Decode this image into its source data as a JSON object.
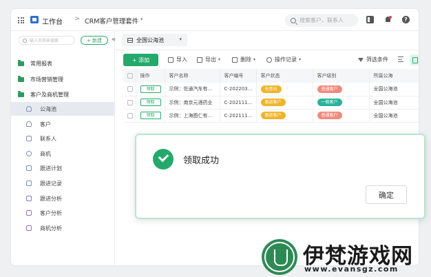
{
  "topbar": {
    "workspace_label": "工作台",
    "crumb_separator": ">",
    "app_title": "CRM客户管理套件",
    "app_caret": "▾",
    "search_placeholder": "搜索客户、联系人",
    "help_label": "?"
  },
  "sidebar": {
    "search_placeholder": "输入名称来搜索",
    "new_label": "+ 新建",
    "collapse_label": "«",
    "groups": [
      "常用报表",
      "市场营销管理",
      "客户及商机管理"
    ],
    "items": [
      {
        "label": "公海池",
        "icon": "person-icon",
        "active": true
      },
      {
        "label": "客户",
        "icon": "person-icon"
      },
      {
        "label": "联系人",
        "icon": "contact-card-icon"
      },
      {
        "label": "商机",
        "icon": "target-icon"
      },
      {
        "label": "跟进计划",
        "icon": "calendar-icon"
      },
      {
        "label": "跟进记录",
        "icon": "calendar-icon"
      },
      {
        "label": "跟进分析",
        "icon": "screen-chart-icon"
      },
      {
        "label": "客户分析",
        "icon": "screen-chart-icon"
      },
      {
        "label": "商机分析",
        "icon": "screen-chart-icon"
      }
    ]
  },
  "main": {
    "pool_tab": "全国公海池",
    "toolbar": {
      "add": "+ 添加",
      "import": "导入",
      "export": "导出",
      "delete": "删除",
      "log": "操作记录",
      "filter": "筛选条件"
    },
    "table": {
      "headers": [
        "操作",
        "客户名称",
        "客户编号",
        "客户状态",
        "客户级别",
        "所属公海"
      ],
      "rows": [
        {
          "action": "领取",
          "name": "示例：佐通汽车有...",
          "code": "C-202203...",
          "status": "无意向",
          "status_color": "#f0b429",
          "level": "普通客户",
          "level_color": "#f08a7e",
          "pool": "全国公海池"
        },
        {
          "action": "领取",
          "name": "示例：南京元酒药业",
          "code": "C-202111...",
          "status": "跟进客户",
          "status_color": "#f0b429",
          "level": "一般客户",
          "level_color": "#2bb39a",
          "pool": "全国公海池"
        },
        {
          "action": "领取",
          "name": "示例：上海图仁有...",
          "code": "C-202111...",
          "status": "跟进客户",
          "status_color": "#f0b429",
          "level": "普通客户",
          "level_color": "#f08a7e",
          "pool": "全国公海池"
        }
      ]
    }
  },
  "dialog": {
    "message": "领取成功",
    "ok_label": "确定"
  },
  "watermark": {
    "title": "伊梵游戏网",
    "url": "www.evansgz.com"
  }
}
